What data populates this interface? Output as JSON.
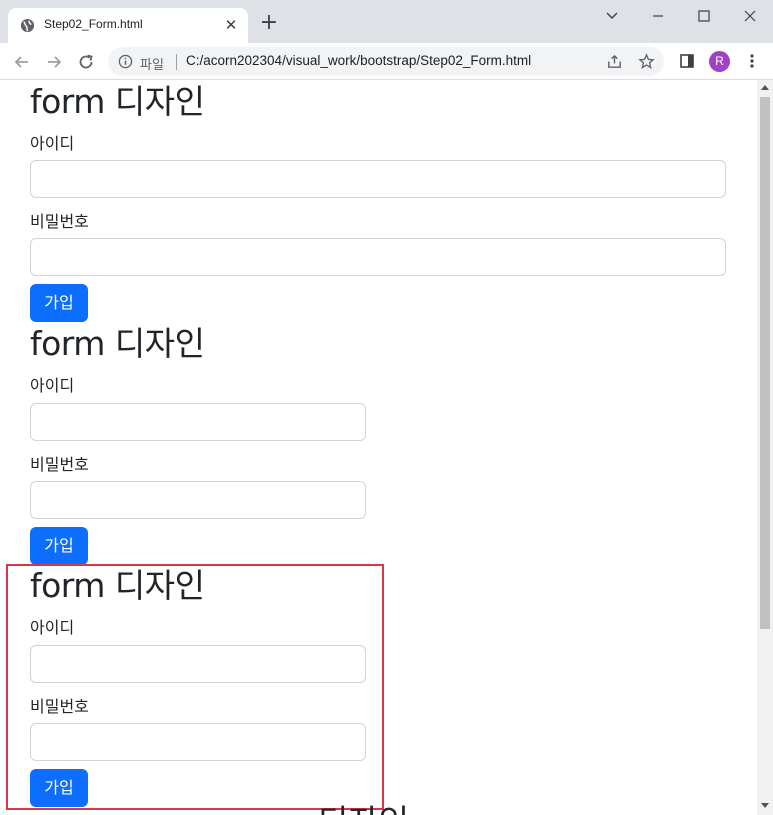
{
  "browser": {
    "tab_title": "Step02_Form.html",
    "tab_close": "✕",
    "new_tab": "+",
    "scheme_label": "파일",
    "url": "C:/acorn202304/visual_work/bootstrap/Step02_Form.html",
    "avatar_letter": "R",
    "avatar_color": "#a142c5"
  },
  "forms": [
    {
      "title": "form 디자인",
      "id_label": "아이디",
      "pw_label": "비밀번호",
      "id_value": "",
      "pw_value": "",
      "submit_label": "가입"
    },
    {
      "title": "form 디자인",
      "id_label": "아이디",
      "pw_label": "비밀번호",
      "id_value": "",
      "pw_value": "",
      "submit_label": "가입"
    },
    {
      "title": "form 디자인",
      "id_label": "아이디",
      "pw_label": "비밀번호",
      "id_value": "",
      "pw_value": "",
      "submit_label": "가입"
    }
  ],
  "partial_title": "디자인",
  "colors": {
    "primary_button": "#0d6efd",
    "highlight_border": "#dc3545"
  }
}
